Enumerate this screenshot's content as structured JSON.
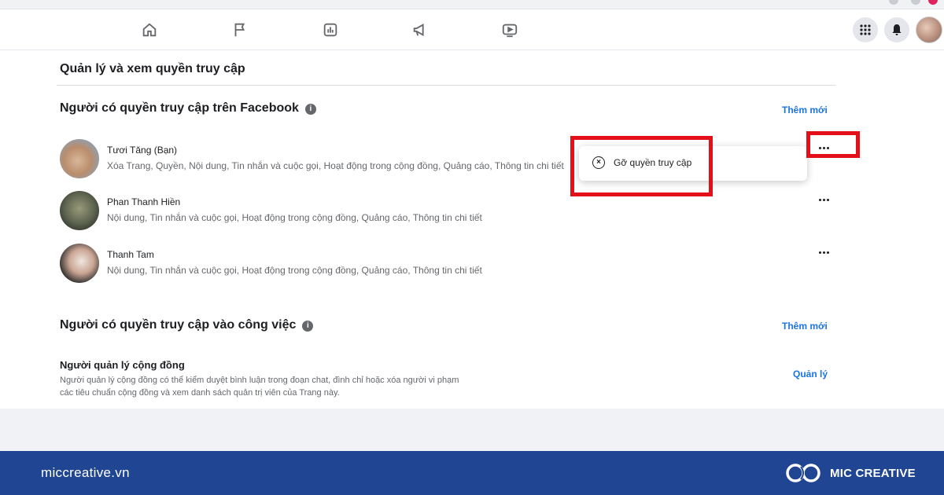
{
  "nav": {
    "icons": [
      "home-icon",
      "flag-icon",
      "insights-icon",
      "megaphone-icon",
      "video-icon"
    ],
    "right_icons": [
      "apps-grid-icon",
      "bell-icon",
      "profile-avatar"
    ]
  },
  "page": {
    "heading": "Quản lý và xem quyền truy cập"
  },
  "facebook_access": {
    "title": "Người có quyền truy cập trên Facebook",
    "add_label": "Thêm mới",
    "people": [
      {
        "name": "Tươi Tăng (Bạn)",
        "permissions": "Xóa Trang, Quyền, Nội dung, Tin nhắn và cuộc gọi, Hoạt động trong cộng đồng, Quảng cáo, Thông tin chi tiết"
      },
      {
        "name": "Phan Thanh Hiền",
        "permissions": "Nội dung, Tin nhắn và cuộc gọi, Hoạt động trong cộng đồng, Quảng cáo, Thông tin chi tiết"
      },
      {
        "name": "Thanh Tam",
        "permissions": "Nội dung, Tin nhắn và cuộc gọi, Hoạt động trong cộng đồng, Quảng cáo, Thông tin chi tiết"
      }
    ]
  },
  "popup_menu": {
    "remove_access_label": "Gỡ quyền truy cập",
    "highlight_color": "#e3101a"
  },
  "task_access": {
    "title": "Người có quyền truy cập vào công việc",
    "add_label": "Thêm mới",
    "role_title": "Người quản lý cộng đồng",
    "role_desc": "Người quản lý cộng đồng có thể kiểm duyệt bình luận trong đoạn chat, đình chỉ hoặc xóa người vi phạm các tiêu chuẩn cộng đồng và xem danh sách quản trị viên của Trang này.",
    "manage_label": "Quản lý"
  },
  "footer": {
    "site": "miccreative.vn",
    "brand": "MIC CREATIVE",
    "background": "#1f4593"
  },
  "colors": {
    "accent": "#1b74e4",
    "text": "#1c1e21",
    "secondary_text": "#65676b"
  }
}
